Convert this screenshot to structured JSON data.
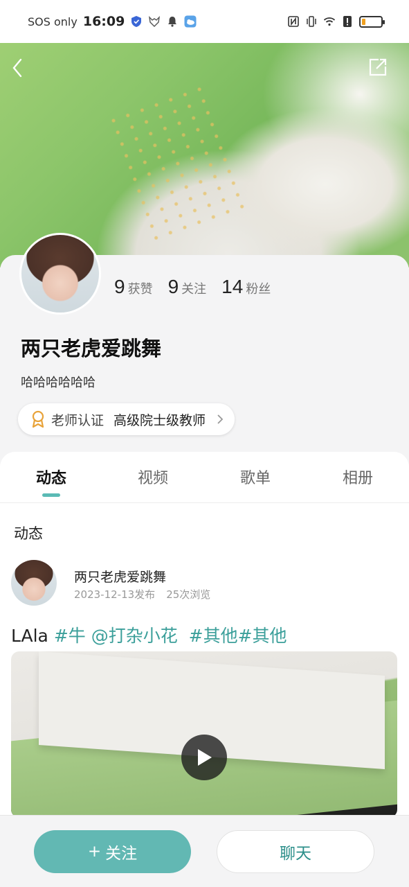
{
  "status_bar": {
    "network": "SOS only",
    "time": "16:09"
  },
  "profile": {
    "stats": [
      {
        "num": "9",
        "label": "获赞"
      },
      {
        "num": "9",
        "label": "关注"
      },
      {
        "num": "14",
        "label": "粉丝"
      }
    ],
    "name": "两只老虎爱跳舞",
    "bio": "哈哈哈哈哈哈",
    "certification": {
      "label": "老师认证",
      "title": "高级院士级教师"
    }
  },
  "tabs": [
    {
      "label": "动态",
      "active": true
    },
    {
      "label": "视频",
      "active": false
    },
    {
      "label": "歌单",
      "active": false
    },
    {
      "label": "相册",
      "active": false
    }
  ],
  "feed": {
    "section_title": "动态",
    "post": {
      "author": "两只老虎爱跳舞",
      "date": "2023-12-13发布",
      "views": "25次浏览",
      "text_plain": "LAla",
      "tags": [
        "#牛",
        "@打杂小花",
        "#其他#其他"
      ]
    }
  },
  "actions": {
    "follow_icon": "+",
    "follow": "关注",
    "chat": "聊天"
  },
  "colors": {
    "accent": "#62b8b3",
    "tag": "#3b9f9a",
    "battery": "#f0a020"
  }
}
